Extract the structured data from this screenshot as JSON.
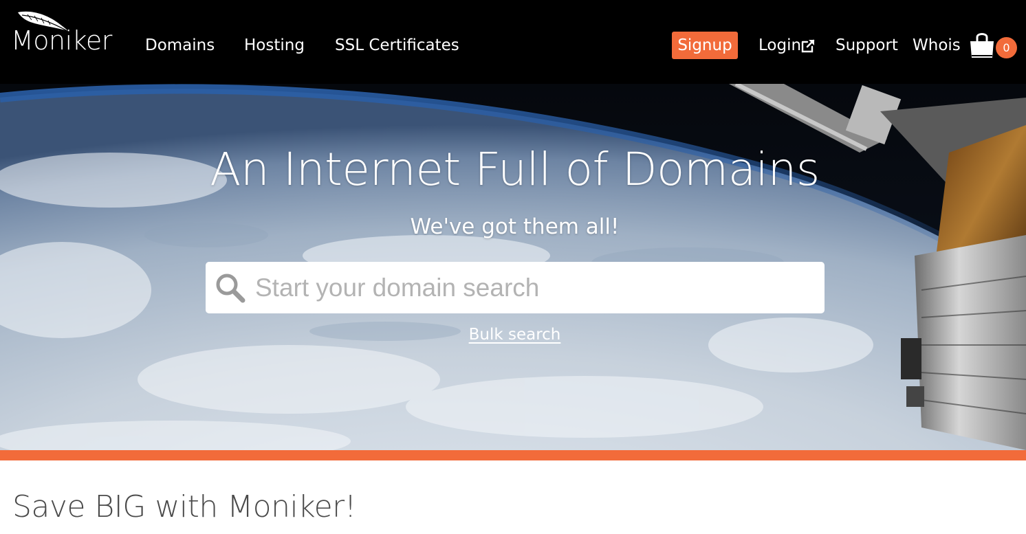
{
  "brand": {
    "name": "Moniker",
    "accent": "#f26b3a",
    "nav_bg": "#000000"
  },
  "nav": {
    "domains": "Domains",
    "hosting": "Hosting",
    "ssl": "SSL Certificates",
    "signup": "Signup",
    "login": "Login",
    "support": "Support",
    "whois": "Whois",
    "cart_count": "0",
    "login_icon": "external-link-icon",
    "cart_icon": "shopping-bag-icon"
  },
  "hero": {
    "title": "An Internet Full of Domains",
    "subtitle": "We've got them all!",
    "search_placeholder": "Start your domain search",
    "search_icon": "search-icon",
    "bulk_link": "Bulk search"
  },
  "promo": {
    "heading": "Save BIG with Moniker!"
  }
}
